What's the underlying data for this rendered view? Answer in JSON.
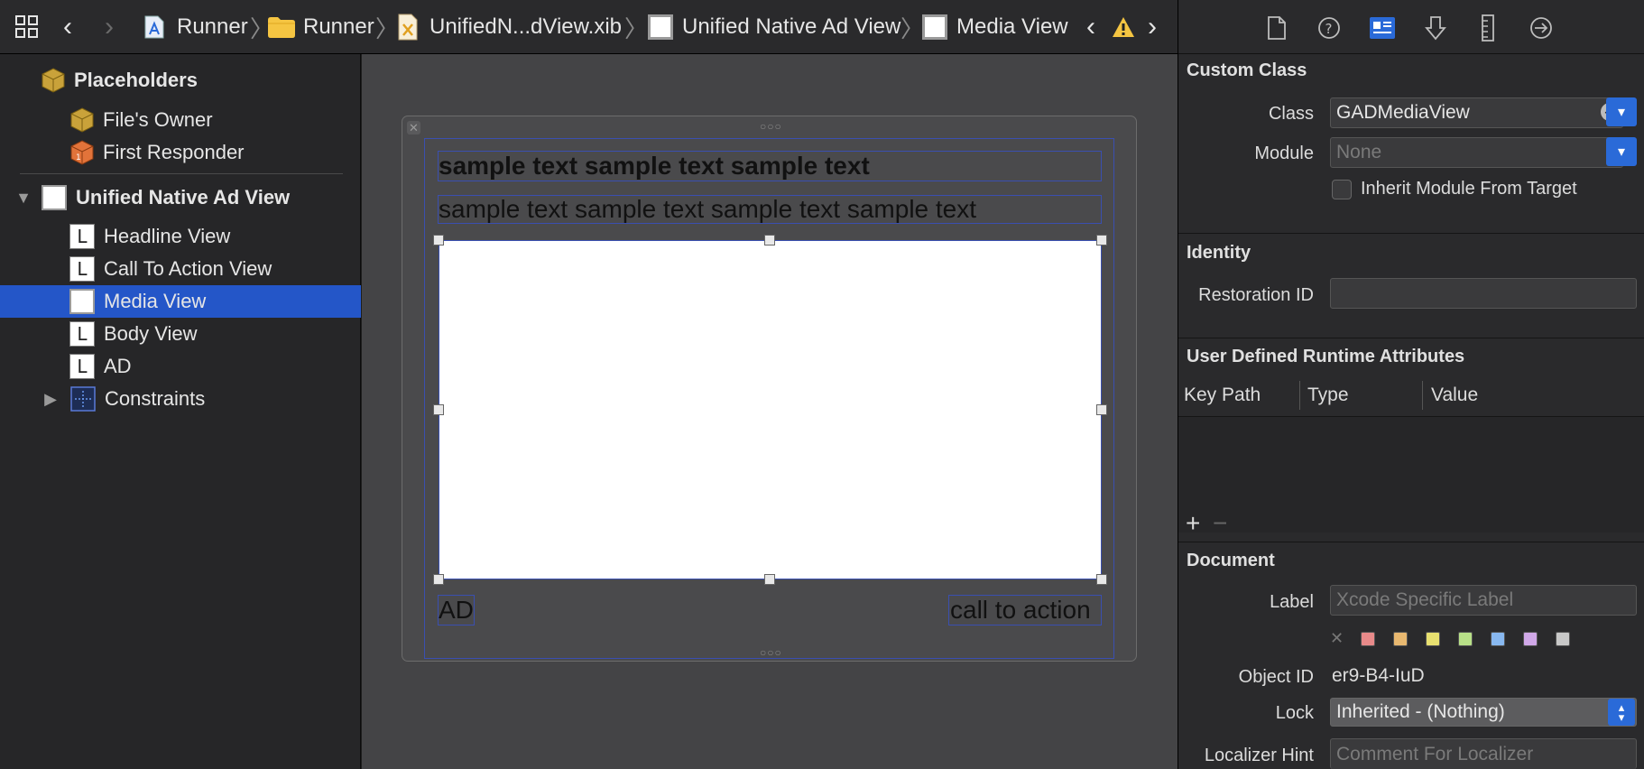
{
  "breadcrumb": {
    "items": [
      {
        "label": "Runner",
        "icon": "app-target-icon"
      },
      {
        "label": "Runner",
        "icon": "folder-icon"
      },
      {
        "label": "UnifiedN...dView.xib",
        "icon": "xib-file-icon"
      },
      {
        "label": "Unified Native Ad View",
        "icon": "view-icon"
      },
      {
        "label": "Media View",
        "icon": "view-icon"
      }
    ],
    "warning_icon": "warning-icon"
  },
  "navigator": {
    "placeholders_label": "Placeholders",
    "files_owner": "File's Owner",
    "first_responder": "First Responder",
    "root_view": "Unified Native Ad View",
    "children": [
      {
        "label": "Headline View",
        "glyph": "L"
      },
      {
        "label": "Call To Action View",
        "glyph": "L"
      },
      {
        "label": "Media View",
        "glyph": ""
      },
      {
        "label": "Body View",
        "glyph": "L"
      },
      {
        "label": "AD",
        "glyph": "L"
      }
    ],
    "constraints": "Constraints",
    "selected_index": 2
  },
  "canvas": {
    "headline": "sample text sample text sample text",
    "body": "sample text sample text sample text sample text",
    "ad_label": "AD",
    "call_to_action": "call to action"
  },
  "inspector": {
    "custom_class": {
      "title": "Custom Class",
      "class_label": "Class",
      "class_value": "GADMediaView",
      "module_label": "Module",
      "module_placeholder": "None",
      "inherit_label": "Inherit Module From Target"
    },
    "identity": {
      "title": "Identity",
      "restoration_label": "Restoration ID",
      "restoration_value": ""
    },
    "runtime_attrs": {
      "title": "User Defined Runtime Attributes",
      "columns": [
        "Key Path",
        "Type",
        "Value"
      ]
    },
    "document": {
      "title": "Document",
      "label_label": "Label",
      "label_placeholder": "Xcode Specific Label",
      "object_id_label": "Object ID",
      "object_id_value": "er9-B4-IuD",
      "lock_label": "Lock",
      "lock_value": "Inherited - (Nothing)",
      "localizer_label": "Localizer Hint",
      "localizer_placeholder": "Comment For Localizer",
      "swatch_colors": [
        "#e88a8a",
        "#e8b870",
        "#e8e070",
        "#b8e088",
        "#88b8f0",
        "#d0a8e8",
        "#c8c8c8"
      ]
    }
  }
}
